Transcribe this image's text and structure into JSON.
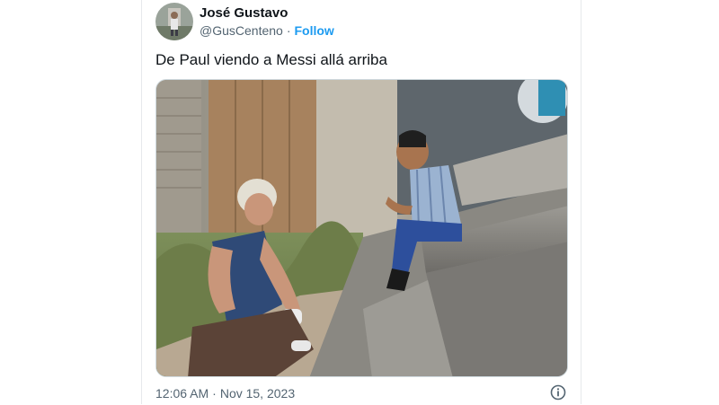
{
  "author": {
    "name": "José Gustavo",
    "handle": "@GusCenteno",
    "separator": "·",
    "follow_label": "Follow"
  },
  "tweet": {
    "text": "De Paul viendo a Messi allá arriba",
    "time": "12:06 AM",
    "dot": "·",
    "date": "Nov 15, 2023"
  },
  "icons": {
    "info": "info-icon"
  },
  "colors": {
    "link": "#1d9bf0",
    "muted": "#536471",
    "text": "#0f1419"
  }
}
